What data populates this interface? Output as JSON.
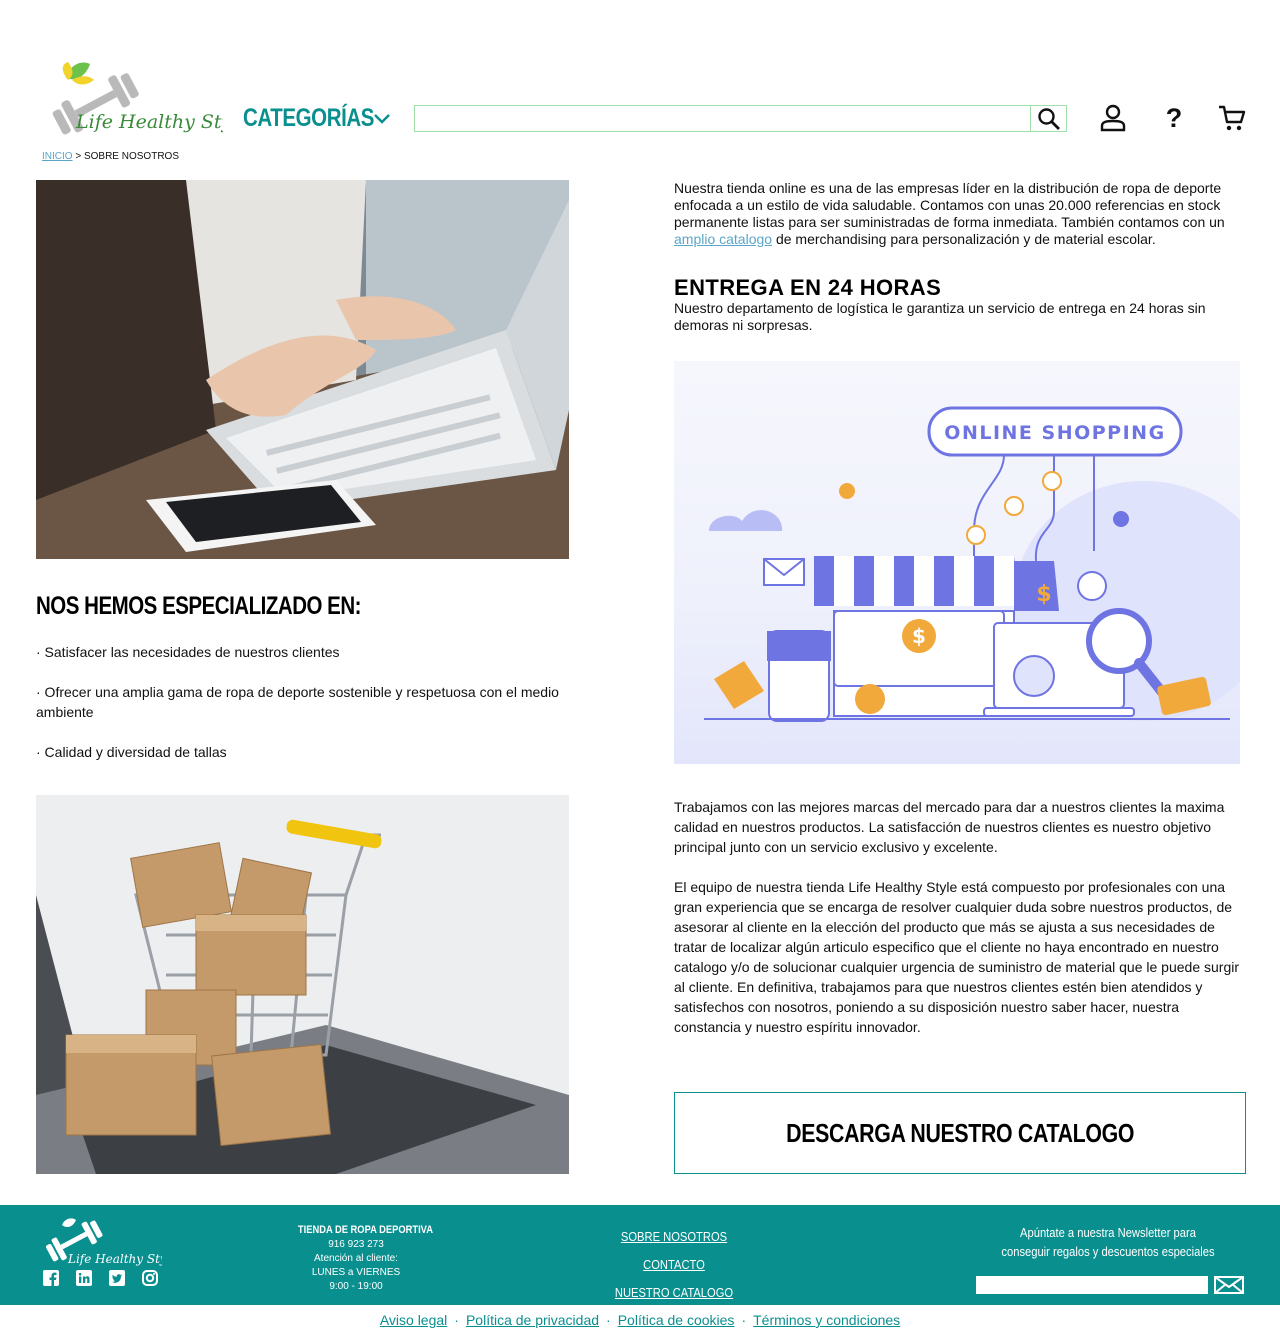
{
  "header": {
    "logo_text": "Life Healthy Style",
    "categories_label": "CATEGORÍAS",
    "search_placeholder": "",
    "icons": [
      "user-icon",
      "help-icon",
      "cart-icon"
    ],
    "help_glyph": "?"
  },
  "breadcrumb": {
    "home": "INICIO",
    "separator": ">",
    "current": "SOBRE NOSOTROS"
  },
  "intro": {
    "text_before_link": "Nuestra tienda online es una de las empresas líder en la distribución de ropa de deporte enfocada a un estilo de vida saludable. Contamos con unas 20.000 referencias en stock permanente listas para ser suministradas de forma inmediata. También contamos con un ",
    "link_text": "amplio catalogo",
    "text_after_link": " de merchandising para personalización y de material escolar."
  },
  "delivery": {
    "title": "ENTREGA EN 24 HORAS",
    "text": "Nuestro departamento de logística le garantiza un servicio de entrega en 24 horas sin demoras ni sorpresas."
  },
  "illustration": {
    "banner_text": "ONLINE SHOPPING"
  },
  "specialized": {
    "title": "NOS HEMOS ESPECIALIZADO EN:",
    "items": [
      "· Satisfacer las necesidades de nuestros clientes",
      "· Ofrecer una amplia gama de ropa de deporte sostenible y respetuosa con el medio ambiente",
      "· Calidad y diversidad de tallas"
    ]
  },
  "paragraphs": [
    "Trabajamos con las mejores marcas del mercado para dar a nuestros clientes la maxima calidad en nuestros productos. La satisfacción de nuestros clientes es nuestro objetivo principal junto con un servicio exclusivo y excelente.",
    "El equipo de nuestra tienda Life Healthy Style está compuesto por profesionales con una gran experiencia que se encarga de resolver cualquier duda sobre nuestros productos, de asesorar al cliente en la elección del producto que más se ajusta a sus necesidades de tratar de localizar algún articulo especifico que el cliente no haya encontrado en nuestro catalogo y/o de solucionar  cualquier urgencia de suministro de material que le puede surgir al cliente. En definitiva, trabajamos para que nuestros clientes estén bien atendidos y satisfechos con nosotros, poniendo a su disposición nuestro saber hacer, nuestra constancia y nuestro espíritu innovador."
  ],
  "catalog_button": "DESCARGA NUESTRO CATALOGO",
  "footer": {
    "logo_text": "Life Healthy Style",
    "social": [
      "facebook-icon",
      "linkedin-icon",
      "twitter-icon",
      "instagram-icon"
    ],
    "info_title": "TIENDA DE ROPA DEPORTIVA",
    "phone": "916 923 273",
    "attention": "Atención al cliente:",
    "days": "LUNES a VIERNES",
    "hours": "9:00 - 19:00",
    "links": [
      "SOBRE NOSOTROS",
      "CONTACTO",
      "NUESTRO CATALOGO"
    ],
    "newsletter_text": "Apúntate a nuestra Newsletter para conseguir regalos y descuentos especiales",
    "newsletter_placeholder": ""
  },
  "legal_links": [
    "Aviso legal",
    "Política de privacidad",
    "Política de cookies",
    "Términos y condiciones"
  ],
  "legal_separator": "·",
  "colors": {
    "brand_teal": "#0a8f8f",
    "link_blue": "#5aa6c9",
    "search_border": "#9fdea6",
    "logo_green": "#6cc24a",
    "logo_yellow": "#f2d32c",
    "illustration_purple": "#6f74e3"
  }
}
